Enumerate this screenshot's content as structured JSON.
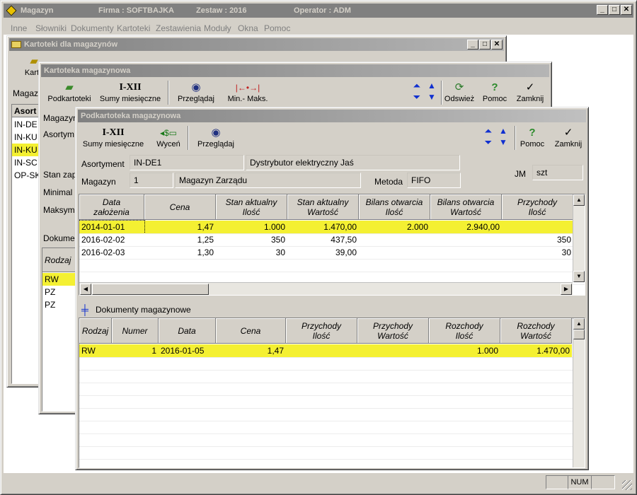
{
  "app": {
    "title": "Magazyn",
    "firma": "Firma : SOFTBAJKA",
    "zestaw": "Zestaw : 2016",
    "operator": "Operator : ADM"
  },
  "menu": [
    "Inne",
    "Słowniki",
    "Dokumenty",
    "Kartoteki",
    "Zestawienia",
    "Moduły",
    "Okna",
    "Pomoc"
  ],
  "win1": {
    "title": "Kartoteki dla magazynów",
    "toolbar_label": "Karto",
    "label_magaz": "Magaz",
    "list_header": "Asort",
    "list_items": [
      "IN-DE",
      "IN-KU",
      "IN-KU",
      "IN-SC",
      "OP-SK"
    ]
  },
  "win2": {
    "title": "Kartoteka magazynowa",
    "tools": {
      "podkartoteki": "Podkartoteki",
      "sumy": "Sumy miesięczne",
      "sumy_icon": "I-XII",
      "przegladaj": "Przeglądaj",
      "minmaks": "Min.- Maks.",
      "odswiez": "Odswież",
      "pomoc": "Pomoc",
      "zamknij": "Zamknij"
    },
    "labels": {
      "magaz": "Magazyn",
      "asort": "Asortym",
      "stan": "Stan zap",
      "minimal": "Minimal",
      "maksym": "Maksym",
      "dokum": "Dokumen"
    },
    "doc_header": "Rodzaj",
    "doc_items": [
      "RW",
      "PZ",
      "PZ"
    ]
  },
  "win3": {
    "title": "Podkartoteka magazynowa",
    "tools": {
      "sumy_icon": "I-XII",
      "sumy": "Sumy miesięczne",
      "wycen": "Wyceń",
      "przegladaj": "Przeglądaj",
      "pomoc": "Pomoc",
      "zamknij": "Zamknij"
    },
    "form": {
      "asortyment_label": "Asortyment",
      "asortyment_code": "IN-DE1",
      "asortyment_name": "Dystrybutor elektryczny Jaś",
      "magazyn_label": "Magazyn",
      "magazyn_no": "1",
      "magazyn_name": "Magazyn Zarządu",
      "metoda_label": "Metoda",
      "metoda_value": "FIFO",
      "jm_label": "JM",
      "jm_value": "szt"
    },
    "grid1": {
      "headers": [
        "Data\nzałożenia",
        "Cena",
        "Stan aktualny\nIlość",
        "Stan aktualny\nWartość",
        "Bilans otwarcia\nIlość",
        "Bilans otwarcia\nWartość",
        "Przychody\nIlość"
      ],
      "rows": [
        [
          "2014-01-01",
          "1,47",
          "1.000",
          "1.470,00",
          "2.000",
          "2.940,00",
          ""
        ],
        [
          "2016-02-02",
          "1,25",
          "350",
          "437,50",
          "",
          "",
          "350"
        ],
        [
          "2016-02-03",
          "1,30",
          "30",
          "39,00",
          "",
          "",
          "30"
        ]
      ]
    },
    "docs_title": "Dokumenty magazynowe",
    "grid2": {
      "headers": [
        "Rodzaj",
        "Numer",
        "Data",
        "Cena",
        "Przychody\nIlość",
        "Przychody\nWartość",
        "Rozchody\nIlość",
        "Rozchody\nWartość"
      ],
      "rows": [
        [
          "RW",
          "1",
          "2016-01-05",
          "1,47",
          "",
          "",
          "1.000",
          "1.470,00"
        ]
      ]
    }
  },
  "status": {
    "num": "NUM"
  },
  "colors": {
    "selected_row": "#f4f032",
    "face": "#d4d0c8"
  }
}
